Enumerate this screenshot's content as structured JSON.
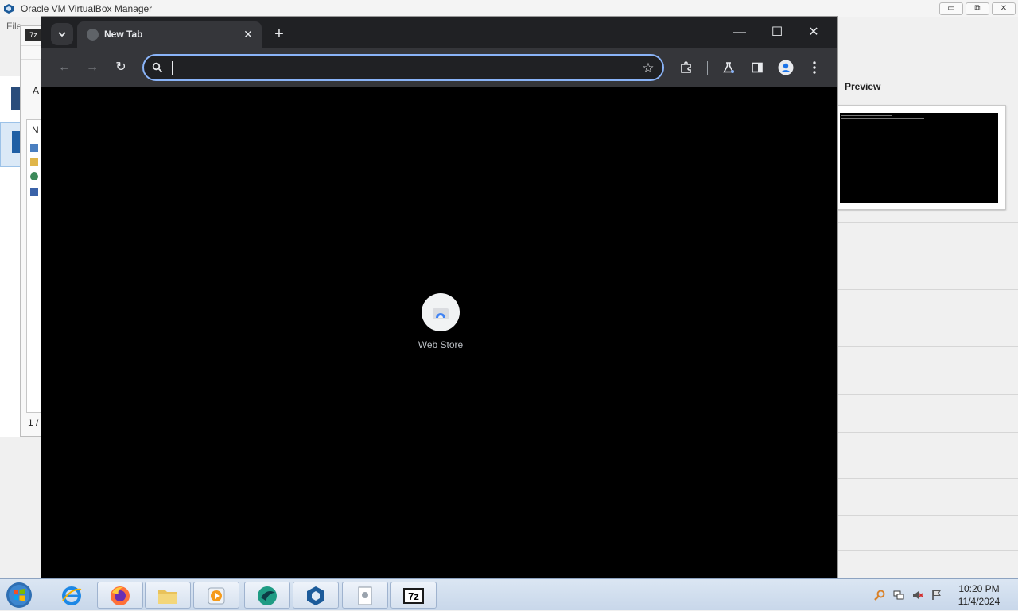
{
  "vbox": {
    "title": "Oracle VM VirtualBox Manager",
    "menu_first": "File",
    "mid_labels": [
      "N",
      "A",
      "1 /"
    ],
    "preview_label": "Preview",
    "window_controls": {
      "minimize": "▭",
      "restore": "⧉",
      "close": "✕"
    }
  },
  "chrome": {
    "tab": {
      "title": "New Tab",
      "close": "✕"
    },
    "new_tab": "+",
    "window_controls": {
      "minimize": "—",
      "maximize": "☐",
      "close": "✕"
    },
    "toolbar": {
      "back": "←",
      "forward": "→",
      "reload": "↻"
    },
    "omnibox": {
      "value": "",
      "placeholder": ""
    },
    "shortcuts": [
      {
        "label": "Web Store"
      }
    ]
  },
  "taskbar": {
    "apps": [
      "internet-explorer",
      "firefox",
      "file-explorer",
      "media-player",
      "webcam-app",
      "virtualbox",
      "document-viewer",
      "7zip"
    ],
    "clock": {
      "time": "10:20 PM",
      "date": "11/4/2024"
    }
  },
  "colors": {
    "chrome_frame": "#202124",
    "chrome_toolbar": "#35363a",
    "accent": "#8ab4f8"
  }
}
